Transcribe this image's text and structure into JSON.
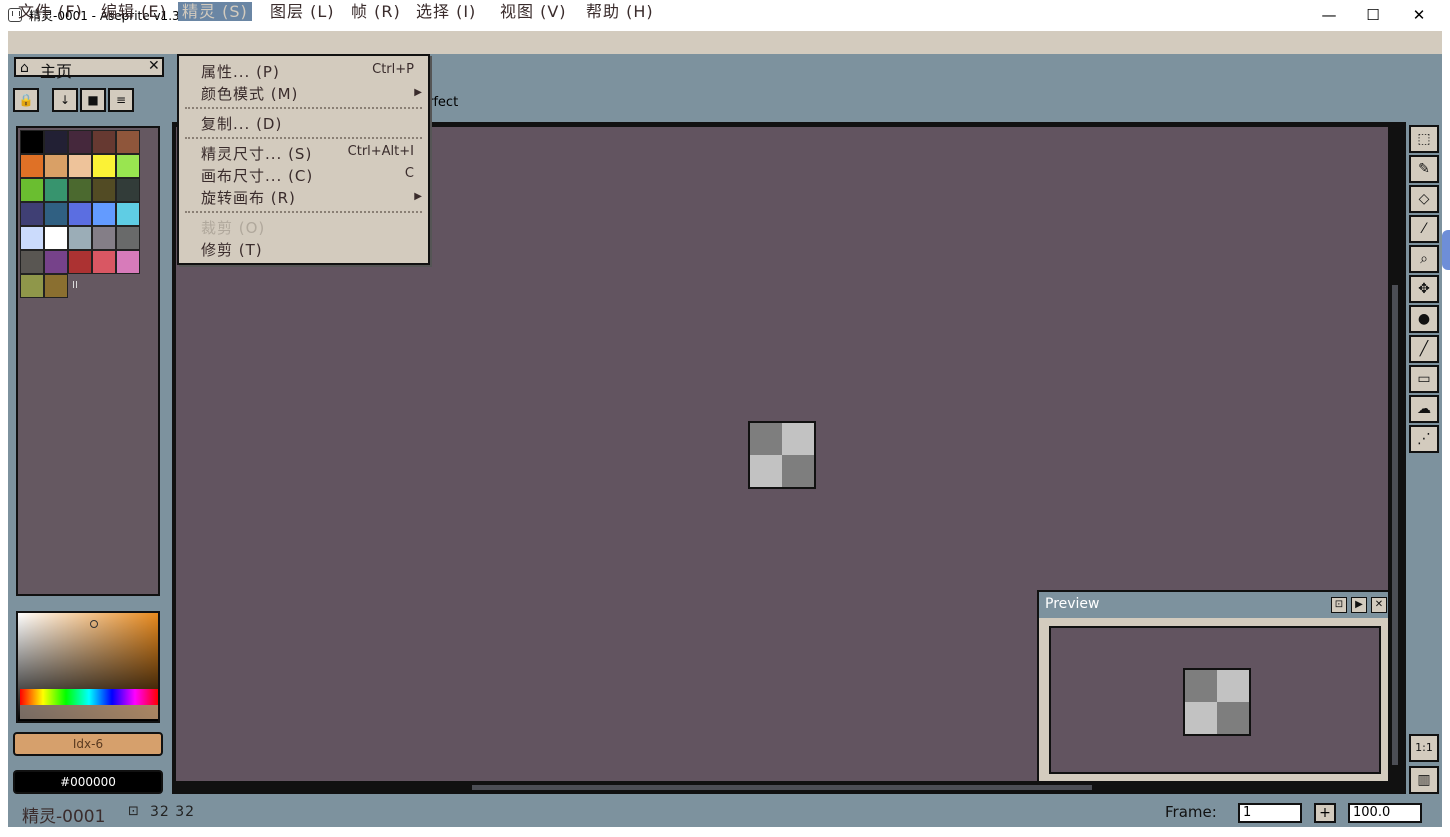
{
  "window": {
    "title": "精灵-0001 - Aseprite v1.3.11",
    "minimize": "—",
    "maximize": "☐",
    "close": "✕"
  },
  "menubar": {
    "items": [
      "文件 (F)",
      "编辑 (E)",
      "精灵 (S)",
      "图层 (L)",
      "帧 (R)",
      "选择 (I)",
      "视图 (V)",
      "帮助 (H)"
    ],
    "active_index": 2
  },
  "home_tab": {
    "label": "主页",
    "close": "✕"
  },
  "left_buttons": {
    "lock": "🔒",
    "down": "↓",
    "stop": "■",
    "menu": "≡"
  },
  "palette": {
    "colors": [
      "#000000",
      "#222034",
      "#45283c",
      "#663931",
      "#8f563b",
      "#df7126",
      "#d9a066",
      "#eec39a",
      "#fbf236",
      "#99e550",
      "#6abe30",
      "#37946e",
      "#4b692f",
      "#524b24",
      "#323c39",
      "#3f3f74",
      "#306082",
      "#5b6ee1",
      "#639bff",
      "#5fcde4",
      "#cbdbfc",
      "#ffffff",
      "#9badb7",
      "#847e87",
      "#696a6a",
      "#595652",
      "#76428a",
      "#ac3232",
      "#d95763",
      "#d77bba",
      "#8f974a",
      "#8a6f30"
    ],
    "marker": "II"
  },
  "colors": {
    "foreground_label": "Idx-6",
    "background_label": "#000000",
    "accent": "#e88a1e"
  },
  "editor": {
    "tab_label": "rfect"
  },
  "tools": [
    {
      "name": "marquee",
      "glyph": "⬚"
    },
    {
      "name": "pencil",
      "glyph": "✎"
    },
    {
      "name": "eraser",
      "glyph": "◇"
    },
    {
      "name": "eyedropper",
      "glyph": "⁄"
    },
    {
      "name": "zoom",
      "glyph": "⌕"
    },
    {
      "name": "move",
      "glyph": "✥"
    },
    {
      "name": "fill",
      "glyph": "●"
    },
    {
      "name": "line",
      "glyph": "╱"
    },
    {
      "name": "rectangle",
      "glyph": "▭"
    },
    {
      "name": "blur",
      "glyph": "☁"
    },
    {
      "name": "spray",
      "glyph": "⋰"
    }
  ],
  "view_buttons": {
    "ratio": "1:1",
    "timeline": "▥"
  },
  "preview": {
    "title": "Preview",
    "btn_fit": "⊡",
    "btn_play": "▶",
    "btn_close": "✕"
  },
  "status": {
    "file": "精灵-0001",
    "size": "32 32",
    "frame_label": "Frame:",
    "frame_value": "1",
    "add_frame": "+",
    "zoom_value": "100.0"
  },
  "sprite_menu": {
    "items": [
      {
        "label": "属性... (P)",
        "shortcut": "Ctrl+P",
        "submenu": false,
        "disabled": false
      },
      {
        "label": "颜色模式 (M)",
        "shortcut": "",
        "submenu": true,
        "disabled": false
      },
      {
        "label": "复制... (D)",
        "shortcut": "",
        "submenu": false,
        "disabled": false
      },
      {
        "label": "精灵尺寸... (S)",
        "shortcut": "Ctrl+Alt+I",
        "submenu": false,
        "disabled": false
      },
      {
        "label": "画布尺寸... (C)",
        "shortcut": "C",
        "submenu": false,
        "disabled": false
      },
      {
        "label": "旋转画布 (R)",
        "shortcut": "",
        "submenu": true,
        "disabled": false
      },
      {
        "label": "裁剪 (O)",
        "shortcut": "",
        "submenu": false,
        "disabled": true
      },
      {
        "label": "修剪 (T)",
        "shortcut": "",
        "submenu": false,
        "disabled": false
      }
    ]
  }
}
